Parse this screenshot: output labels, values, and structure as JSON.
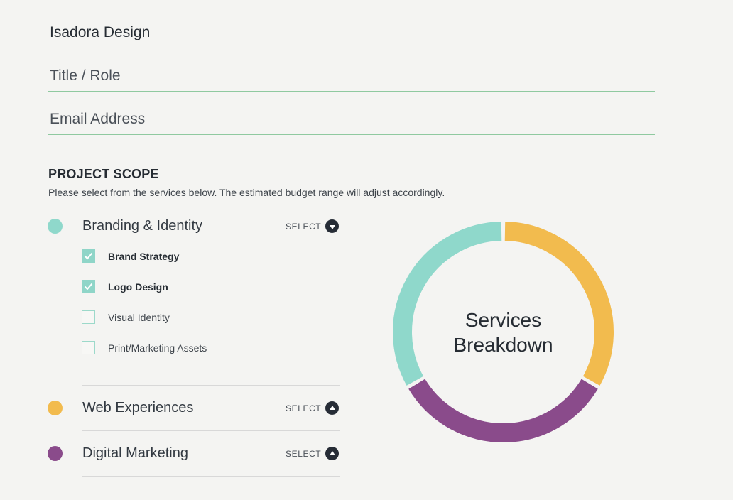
{
  "form": {
    "name_value": "Isadora Design",
    "title_placeholder": "Title / Role",
    "email_placeholder": "Email Address"
  },
  "scope": {
    "heading": "PROJECT SCOPE",
    "description": "Please select from the services below. The estimated budget range will adjust accordingly.",
    "select_label": "SELECT",
    "services": [
      {
        "title": "Branding & Identity",
        "color": "#8fd8cb",
        "expanded": true
      },
      {
        "title": "Web Experiences",
        "color": "#f2bb4e",
        "expanded": false
      },
      {
        "title": "Digital Marketing",
        "color": "#8a4b8b",
        "expanded": false
      }
    ],
    "branding_options": [
      {
        "label": "Brand Strategy",
        "checked": true
      },
      {
        "label": "Logo Design",
        "checked": true
      },
      {
        "label": "Visual Identity",
        "checked": false
      },
      {
        "label": "Print/Marketing Assets",
        "checked": false
      }
    ]
  },
  "chart": {
    "center_line1": "Services",
    "center_line2": "Breakdown",
    "segments": [
      {
        "service": "Web Experiences",
        "color": "#f2bb4e",
        "start_deg": 0,
        "end_deg": 120
      },
      {
        "service": "Digital Marketing",
        "color": "#8a4b8b",
        "start_deg": 120,
        "end_deg": 240
      },
      {
        "service": "Branding & Identity",
        "color": "#8fd8cb",
        "start_deg": 240,
        "end_deg": 360
      }
    ]
  }
}
